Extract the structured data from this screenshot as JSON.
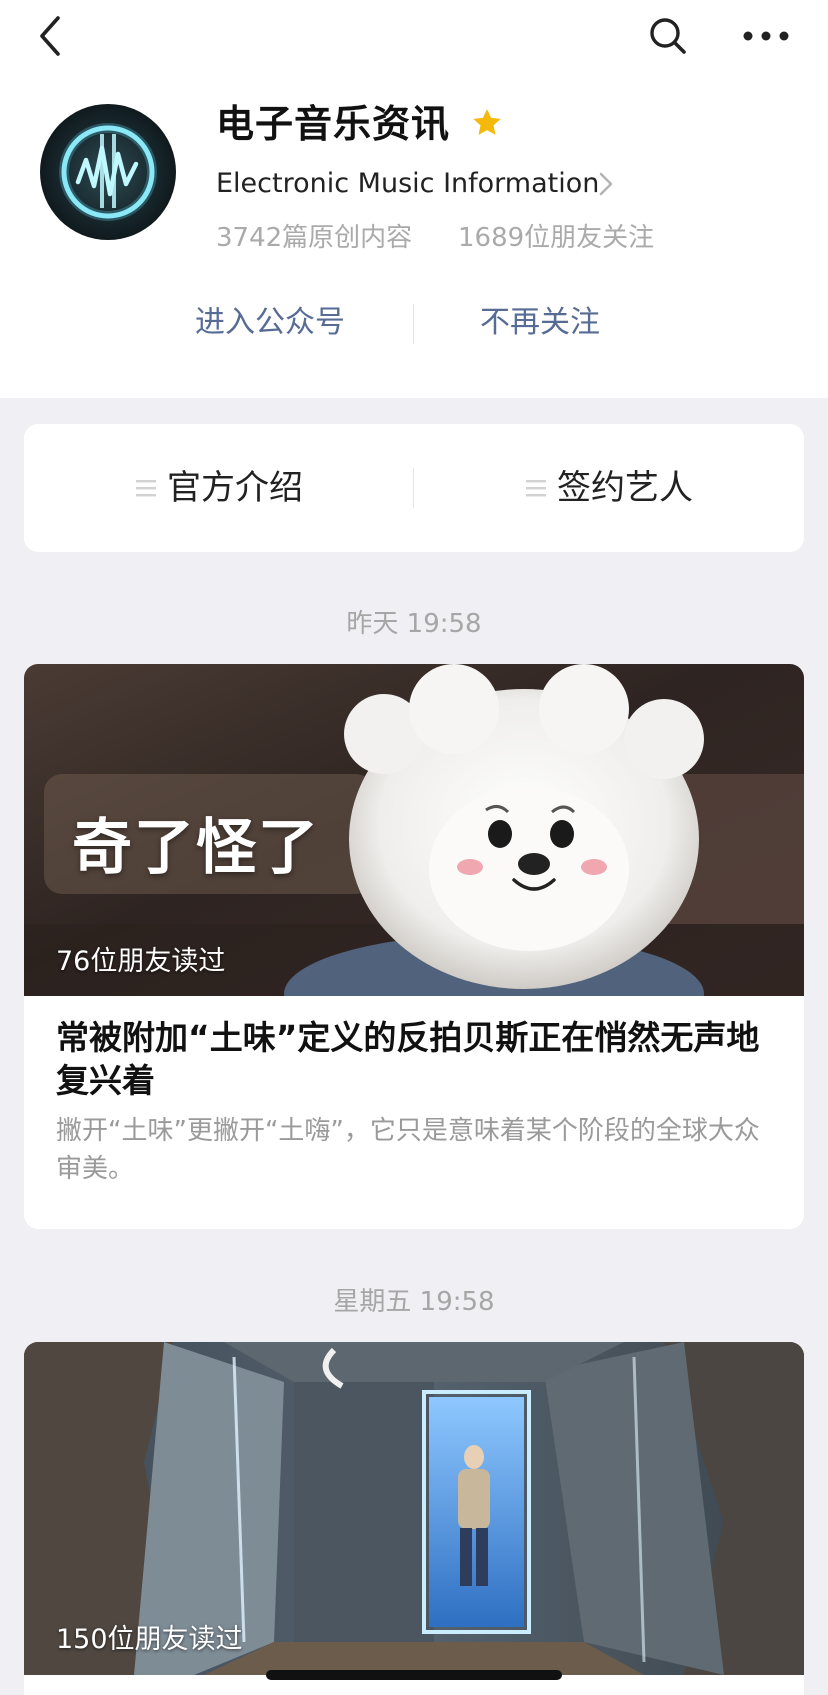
{
  "account": {
    "name": "电子音乐资讯",
    "subtitle": "Electronic Music Information",
    "stats": {
      "original": "3742篇原创内容",
      "followers": "1689位朋友关注"
    },
    "starred": true
  },
  "actions": {
    "enter_label": "进入公众号",
    "unfollow_label": "不再关注"
  },
  "menu": {
    "items": [
      {
        "label": "官方介绍",
        "icon": "menu-lines-icon"
      },
      {
        "label": "签约艺人",
        "icon": "menu-lines-icon"
      }
    ]
  },
  "articles": [
    {
      "timestamp": "昨天 19:58",
      "cover_text": "奇了怪了",
      "read_count": "76位朋友读过",
      "title": "常被附加“土味”定义的反拍贝斯正在悄然无声地复兴着",
      "summary": "撇开“土味”更撇开“土嗨”，它只是意味着某个阶段的全球大众审美。"
    },
    {
      "timestamp": "星期五 19:58",
      "read_count": "150位朋友读过"
    }
  ],
  "colors": {
    "link": "#576b95",
    "star": "#f5b90b",
    "page_background": "#efeff4"
  }
}
